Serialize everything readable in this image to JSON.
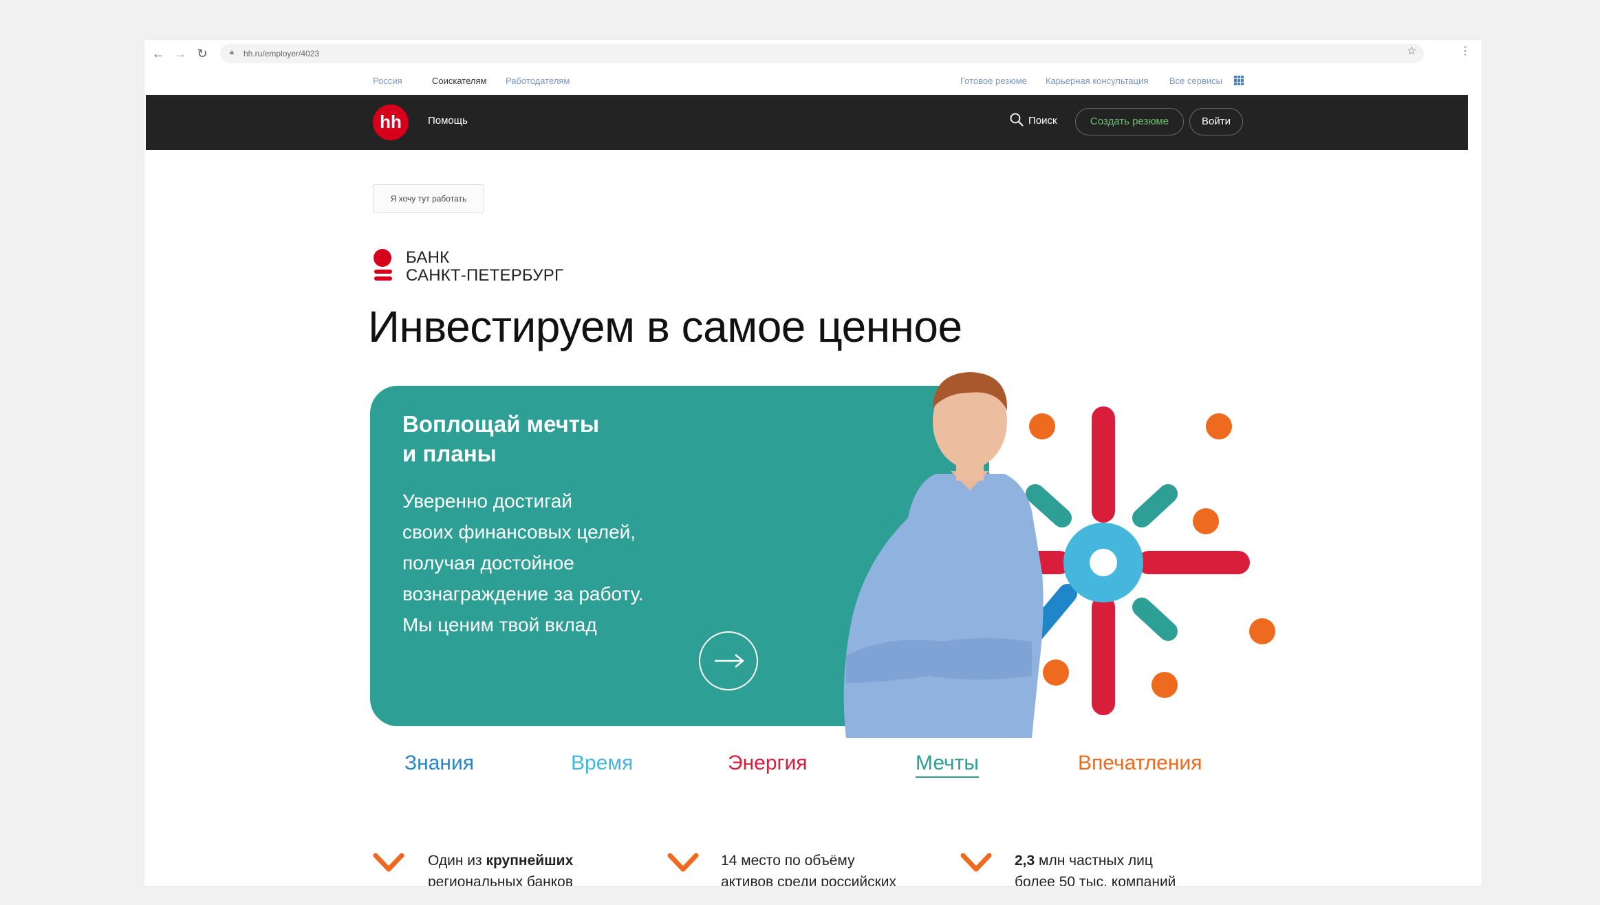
{
  "browser": {
    "url": "hh.ru/employer/4023"
  },
  "topnav": {
    "left_links": [
      "Россия",
      "Соискателям",
      "Работодателям"
    ],
    "right_links": [
      "Готовое резюме",
      "Карьерная консультация",
      "Все сервисы"
    ]
  },
  "header": {
    "logo": "hh",
    "help": "Помощь",
    "search": "Поиск",
    "create_resume": "Создать резюме",
    "login": "Войти"
  },
  "employer": {
    "want_work_button": "Я хочу тут работать",
    "bank_name_line1": "БАНК",
    "bank_name_line2": "САНКТ-ПЕТЕРБУРГ",
    "hero_title": "Инвестируем в самое ценное"
  },
  "hero_card": {
    "title_line1": "Воплощай мечты",
    "title_line2": "и планы",
    "body_lines": [
      "Уверенно достигай",
      "своих финансовых целей,",
      "получая достойное",
      "вознаграждение за работу.",
      "Мы ценим твой вклад"
    ]
  },
  "benefit_tabs": [
    {
      "label": "Знания",
      "color": "#2a86c8"
    },
    {
      "label": "Время",
      "color": "#45b7dc"
    },
    {
      "label": "Энергия",
      "color": "#d81e3a"
    },
    {
      "label": "Мечты",
      "color": "#2d9f95",
      "active": true
    },
    {
      "label": "Впечатления",
      "color": "#ee6a1e"
    }
  ],
  "facts": [
    {
      "line1_bold": "",
      "line1": "Один из ",
      "line1_strong": "крупнейших",
      "line2": "региональных банков"
    },
    {
      "line1_bold": "",
      "line1": "14 место по объёму",
      "line1_strong": "",
      "line2": "активов среди российских"
    },
    {
      "line1_bold": "2,3",
      "line1": " млн частных лиц",
      "line1_strong": "",
      "line2": "более 50 тыс. компаний"
    }
  ],
  "colors": {
    "accent_teal": "#2d9f95",
    "brand_red": "#d6001c",
    "orange": "#ee6a1e",
    "dark_header": "#232323"
  }
}
